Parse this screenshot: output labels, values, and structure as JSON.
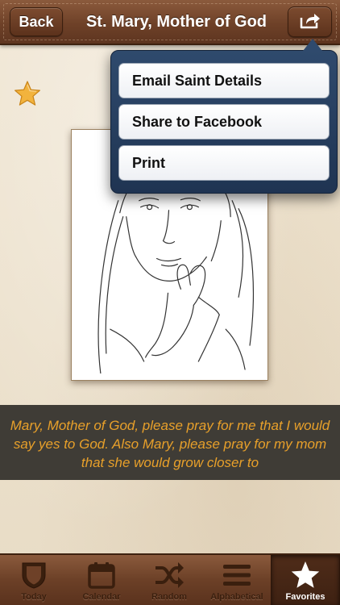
{
  "nav": {
    "back_label": "Back",
    "title": "St. Mary, Mother of God",
    "share_icon": "share-icon"
  },
  "share_menu": {
    "items": [
      {
        "label": "Email Saint Details"
      },
      {
        "label": "Share to Facebook"
      },
      {
        "label": "Print"
      }
    ]
  },
  "favorite": {
    "icon": "star-icon",
    "is_favorite": true
  },
  "portrait": {
    "icon": "saint-sketch-image"
  },
  "prayer": {
    "text": "Mary, Mother of God, please pray for me that I would say yes to God.  Also Mary, please pray for my mom that she would grow closer to"
  },
  "tabbar": {
    "tabs": [
      {
        "label": "Today",
        "icon": "shield-icon",
        "active": false
      },
      {
        "label": "Calendar",
        "icon": "calendar-icon",
        "active": false
      },
      {
        "label": "Random",
        "icon": "shuffle-icon",
        "active": false
      },
      {
        "label": "Alphabetical",
        "icon": "list-icon",
        "active": false
      },
      {
        "label": "Favorites",
        "icon": "star-icon",
        "active": true
      }
    ]
  },
  "colors": {
    "nav_brown": "#6e4128",
    "prayer_bg": "#3f3c36",
    "prayer_text": "#e8a02a",
    "popover_blue": "#2f4a6d",
    "star_gold": "#f2b33d"
  }
}
